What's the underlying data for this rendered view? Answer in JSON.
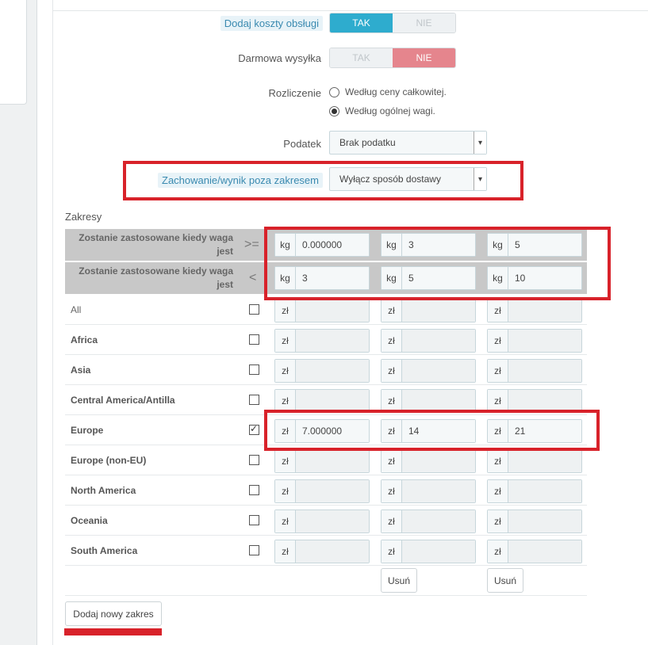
{
  "settings": {
    "handling_costs": {
      "label": "Dodaj koszty obsługi",
      "yes": "TAK",
      "no": "NIE",
      "selected": "TAK"
    },
    "free_shipping": {
      "label": "Darmowa wysyłka",
      "yes": "TAK",
      "no": "NIE",
      "selected": "NIE"
    },
    "billing": {
      "label": "Rozliczenie",
      "options": [
        "Według ceny całkowitej.",
        "Według ogólnej wagi."
      ],
      "selected": "Według ogólnej wagi."
    },
    "tax": {
      "label": "Podatek",
      "value": "Brak podatku"
    },
    "out_of_range": {
      "label": "Zachowanie/wynik poza zakresem",
      "value": "Wyłącz sposób dostawy"
    }
  },
  "ranges": {
    "title": "Zakresy",
    "from_label": "Zostanie zastosowane kiedy waga jest",
    "from_op": ">=",
    "to_label": "Zostanie zastosowane kiedy waga jest",
    "to_op": "<",
    "unit": "kg",
    "currency": "zł",
    "from_values": [
      "0.000000",
      "3",
      "5"
    ],
    "to_values": [
      "3",
      "5",
      "10"
    ],
    "zones": [
      {
        "name": "All",
        "checked": false,
        "prices": [
          "",
          "",
          ""
        ]
      },
      {
        "name": "Africa",
        "checked": false,
        "prices": [
          "",
          "",
          ""
        ]
      },
      {
        "name": "Asia",
        "checked": false,
        "prices": [
          "",
          "",
          ""
        ]
      },
      {
        "name": "Central America/Antilla",
        "checked": false,
        "prices": [
          "",
          "",
          ""
        ]
      },
      {
        "name": "Europe",
        "checked": true,
        "prices": [
          "7.000000",
          "14",
          "21"
        ]
      },
      {
        "name": "Europe (non-EU)",
        "checked": false,
        "prices": [
          "",
          "",
          ""
        ]
      },
      {
        "name": "North America",
        "checked": false,
        "prices": [
          "",
          "",
          ""
        ]
      },
      {
        "name": "Oceania",
        "checked": false,
        "prices": [
          "",
          "",
          ""
        ]
      },
      {
        "name": "South America",
        "checked": false,
        "prices": [
          "",
          "",
          ""
        ]
      }
    ],
    "delete_label": "Usuń",
    "add_range_label": "Dodaj nowy zakres"
  },
  "colors": {
    "accent": "#2eacce",
    "danger": "#e5858d",
    "highlight": "#d8222a"
  }
}
